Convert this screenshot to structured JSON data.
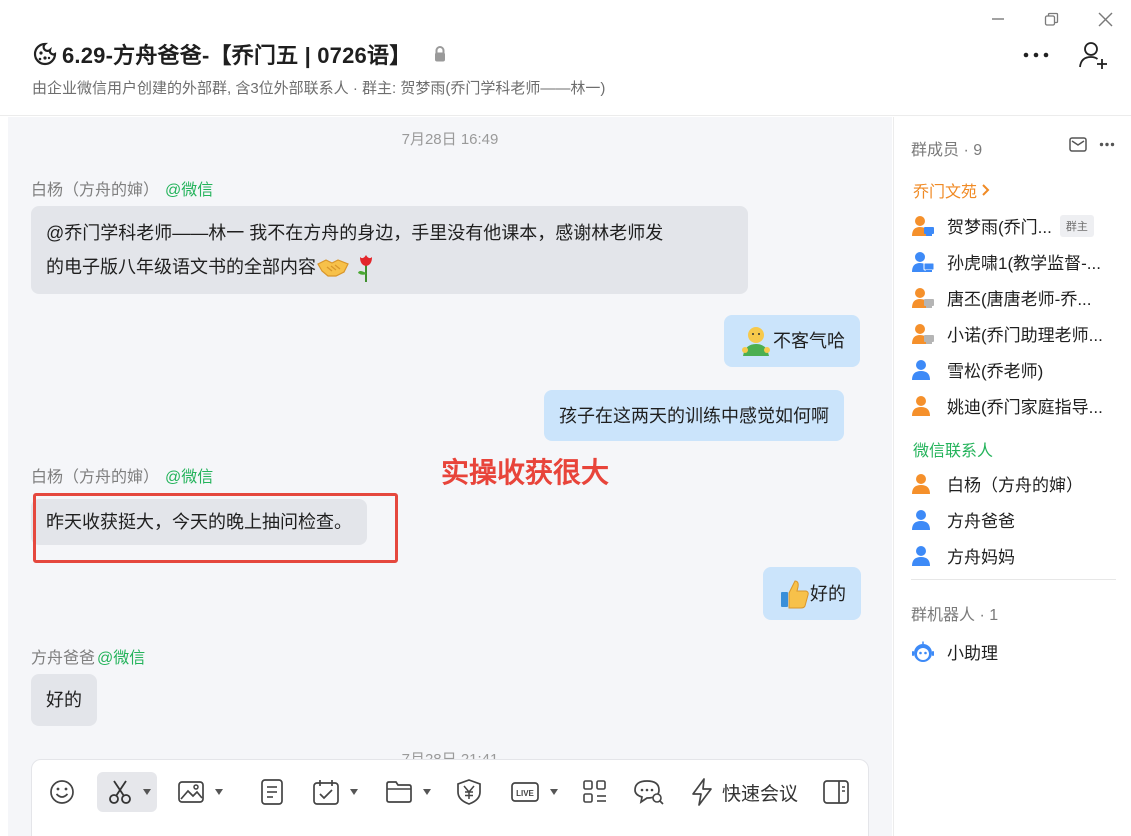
{
  "header": {
    "title": "6.29-方舟爸爸-【乔门五 | 0726语】",
    "subtitle": "由企业微信用户创建的外部群, 含3位外部联系人 · 群主: 贺梦雨(乔门学科老师——林一)"
  },
  "chat": {
    "messages": [
      {
        "kind": "timestamp",
        "text": "7月28日 16:49"
      },
      {
        "kind": "sender",
        "name": "白杨（方舟的婶）",
        "source": "@微信"
      },
      {
        "kind": "in",
        "line1": " @乔门学科老师——林一  我不在方舟的身边，手里没有他课本，感谢林老师发",
        "line2": "的电子版八年级语文书的全部内容"
      },
      {
        "kind": "out",
        "text": "不客气哈"
      },
      {
        "kind": "out",
        "text": "孩子在这两天的训练中感觉如何啊"
      },
      {
        "kind": "sender",
        "name": "白杨（方舟的婶）",
        "source": "@微信"
      },
      {
        "kind": "in",
        "text": "昨天收获挺大，今天的晚上抽问检查。"
      },
      {
        "kind": "out",
        "text": "好的"
      },
      {
        "kind": "sender",
        "name": "方舟爸爸",
        "source": "@微信"
      },
      {
        "kind": "in",
        "text": "好的"
      },
      {
        "kind": "timestamp",
        "text": "7月28日 21:41"
      }
    ],
    "annotation": "实操收获很大"
  },
  "toolbar": {
    "meeting_label": "快速会议",
    "icons": [
      "emoji-icon",
      "scissors-icon",
      "image-icon",
      "document-icon",
      "schedule-icon",
      "folder-icon",
      "payment-icon",
      "live-icon",
      "apps-icon",
      "chat-search-icon",
      "lightning-icon",
      "side-panel-icon"
    ]
  },
  "panel": {
    "members_header": "群成员 · 9",
    "group1": "乔门文苑",
    "members1": [
      {
        "name": "贺梦雨(乔门...",
        "badge": "群主"
      },
      {
        "name": "孙虎啸1(教学监督-..."
      },
      {
        "name": "唐丕(唐唐老师-乔..."
      },
      {
        "name": "小诺(乔门助理老师..."
      },
      {
        "name": "雪松(乔老师)"
      },
      {
        "name": "姚迪(乔门家庭指导..."
      }
    ],
    "group2": "微信联系人",
    "members2": [
      {
        "name": "白杨（方舟的婶）"
      },
      {
        "name": "方舟爸爸"
      },
      {
        "name": "方舟妈妈"
      }
    ],
    "robots_header": "群机器人 · 1",
    "robot": "小助理"
  },
  "colors": {
    "wechat_source": "#24b35b",
    "group_accent": "#f08a24",
    "incoming_bubble": "#e3e5ea",
    "outgoing_bubble": "#cbe4fb",
    "annotation": "#e8443a",
    "blue_icon": "#3d8af7",
    "orange_icon": "#f5902b"
  }
}
